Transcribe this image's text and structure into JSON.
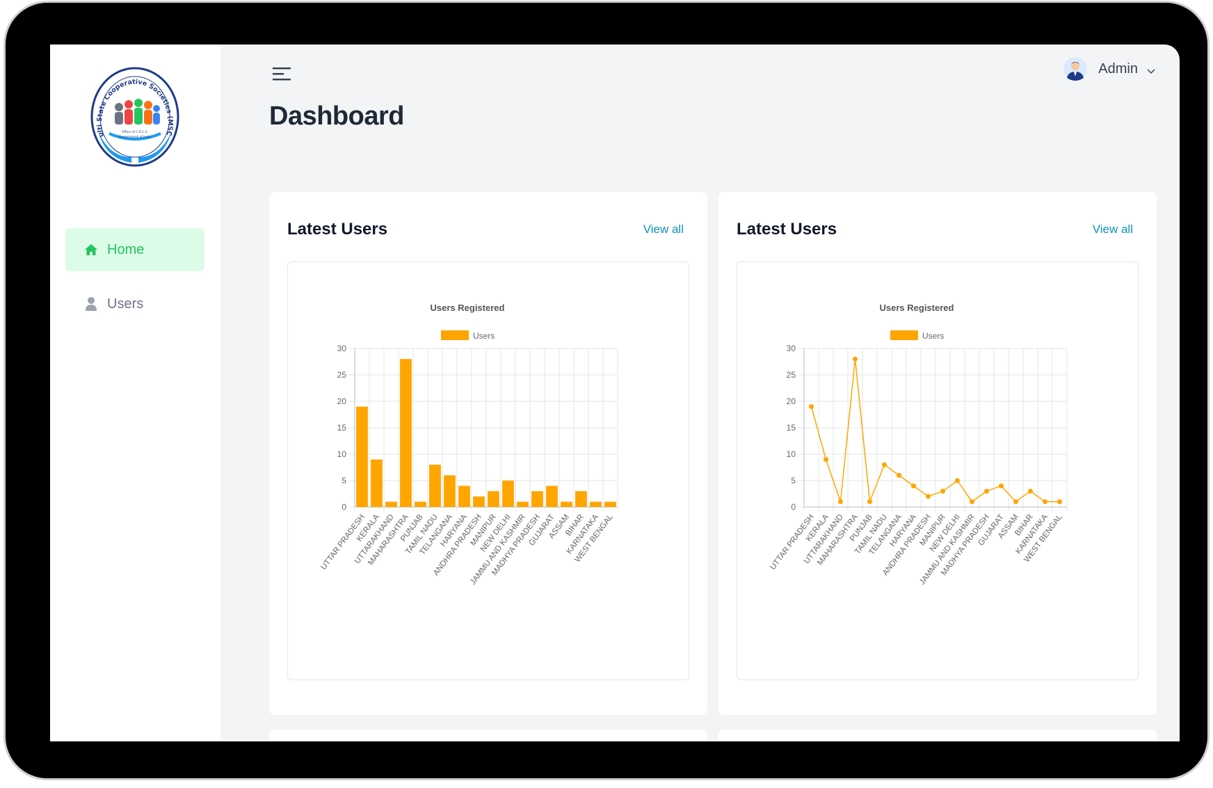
{
  "sidebar": {
    "logo_text": "Multi State Cooperative Societies (MSCS)",
    "logo_sub1": "Office of C.R.C.S.",
    "logo_sub2": "Government of India",
    "items": [
      {
        "label": "Home",
        "icon": "home-icon",
        "active": true
      },
      {
        "label": "Users",
        "icon": "user-icon",
        "active": false
      }
    ]
  },
  "header": {
    "title": "Dashboard",
    "user_name": "Admin"
  },
  "cards": [
    {
      "title": "Latest Users",
      "link": "View all"
    },
    {
      "title": "Latest Users",
      "link": "View all"
    }
  ],
  "colors": {
    "accent": "#ffa500",
    "active_bg": "#dcfce7",
    "active_text": "#22c55e",
    "link": "#0e93b6"
  },
  "chart_data": [
    {
      "type": "bar",
      "title": "Users Registered",
      "legend": "Users",
      "legend_position": "top",
      "categories": [
        "UTTAR PRADESH",
        "KERALA",
        "UTTARAKHAND",
        "MAHARASHTRA",
        "PUNJAB",
        "TAMIL NADU",
        "TELANGANA",
        "HARYANA",
        "ANDHRA PRADESH",
        "MANIPUR",
        "NEW DELHI",
        "JAMMU AND KASHMIR",
        "MADHYA PRADESH",
        "GUJARAT",
        "ASSAM",
        "BIHAR",
        "KARNATAKA",
        "WEST BENGAL"
      ],
      "values": [
        19,
        9,
        1,
        28,
        1,
        8,
        6,
        4,
        2,
        3,
        5,
        1,
        3,
        4,
        1,
        3,
        1,
        1
      ],
      "ylim": [
        0,
        30
      ],
      "yticks": [
        0,
        5,
        10,
        15,
        20,
        25,
        30
      ],
      "grid": true,
      "color": "#ffa500"
    },
    {
      "type": "line",
      "title": "Users Registered",
      "legend": "Users",
      "legend_position": "top",
      "categories": [
        "UTTAR PRADESH",
        "KERALA",
        "UTTARAKHAND",
        "MAHARASHTRA",
        "PUNJAB",
        "TAMIL NADU",
        "TELANGANA",
        "HARYANA",
        "ANDHRA PRADESH",
        "MANIPUR",
        "NEW DELHI",
        "JAMMU AND KASHMIR",
        "MADHYA PRADESH",
        "GUJARAT",
        "ASSAM",
        "BIHAR",
        "KARNATAKA",
        "WEST BENGAL"
      ],
      "values": [
        19,
        9,
        1,
        28,
        1,
        8,
        6,
        4,
        2,
        3,
        5,
        1,
        3,
        4,
        1,
        3,
        1,
        1
      ],
      "ylim": [
        0,
        30
      ],
      "yticks": [
        0,
        5,
        10,
        15,
        20,
        25,
        30
      ],
      "grid": true,
      "color": "#ffa500"
    }
  ]
}
